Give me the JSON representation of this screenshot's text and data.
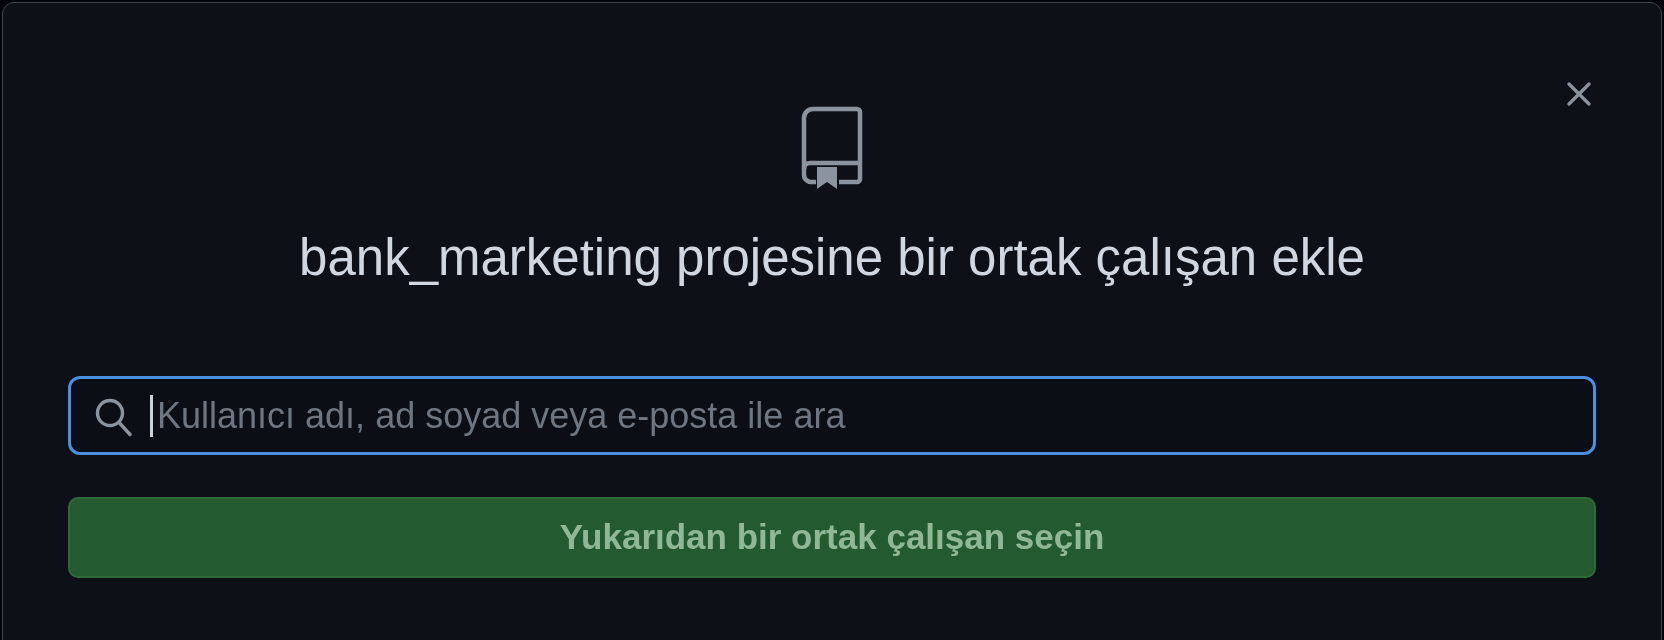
{
  "dialog": {
    "title": "bank_marketing projesine bir ortak çalışan ekle"
  },
  "search": {
    "placeholder": "Kullanıcı adı, ad soyad veya e-posta ile ara",
    "focused": true
  },
  "submit_button": {
    "label": "Yukarıdan bir ortak çalışan seçin",
    "disabled": true
  }
}
